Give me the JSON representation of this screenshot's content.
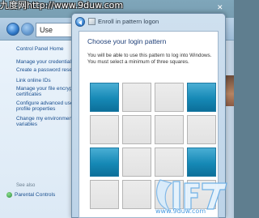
{
  "watermark": {
    "top_text": "九度网http://www.9duw.com",
    "bottom_url": "www.9duw.com"
  },
  "explorer": {
    "address_text": "Use"
  },
  "left_pane": {
    "home": "Control Panel Home",
    "links": [
      "Manage your credentials",
      "Create a password reset disk",
      "Link online IDs",
      "Manage your file encryption",
      "certificates",
      "Configure advanced user",
      "profile properties",
      "Change my environment",
      "variables"
    ],
    "see_also": "See also",
    "parental_controls": "Parental Controls"
  },
  "dialog": {
    "title": "Enroll in pattern logon",
    "heading": "Choose your login pattern",
    "description": "You will be able to use this pattern to log into Windows. You must select a minimum of three squares."
  },
  "pattern": {
    "rows": 4,
    "cols": 4,
    "selected": [
      [
        true,
        false,
        false,
        true
      ],
      [
        false,
        false,
        false,
        false
      ],
      [
        true,
        false,
        false,
        true
      ],
      [
        false,
        false,
        false,
        false
      ]
    ],
    "colors": {
      "selected": "#1689b6",
      "unselected": "#e5e5e5"
    }
  }
}
